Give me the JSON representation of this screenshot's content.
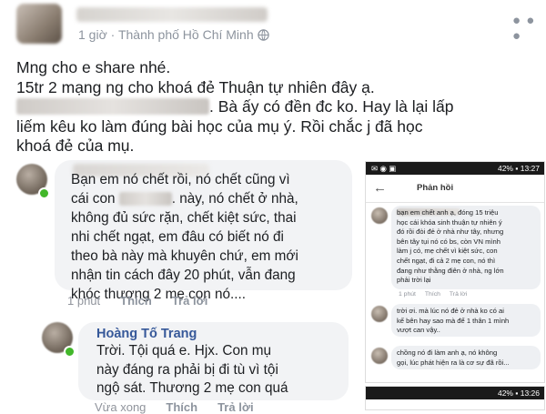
{
  "post": {
    "meta_time": "1 giờ",
    "meta_sep": " · ",
    "meta_location": "Thành phố Hồ Chí Minh",
    "lines": [
      "Mng cho e share nhé.",
      "15tr 2 mạng ng cho khoá đẻ Thuận tự nhiên đây ạ.",
      ". Bà ấy có đền đc ko. Hay là lại lấp",
      "liếm kêu ko làm đúng bài học của mụ ý. Rồi chắc j đã học",
      "khoá đẻ của mụ."
    ]
  },
  "comment1": {
    "lines": [
      "Bạn em nó chết rồi, nó chết cũng vì",
      "cái con",
      ". này, nó chết ở nhà,",
      "không đủ sức rặn, chết kiệt sức, thai",
      "nhi chết ngạt, em đâu có biết nó đi",
      "theo bà này mà khuyên chứ, em mới",
      "nhận tin cách đây 20 phút, vẫn đang",
      "khóc thương 2 mẹ con nó...."
    ],
    "time": "1 phút",
    "like": "Thích",
    "reply": "Trả lời"
  },
  "comment2": {
    "author": "Hoàng Tố Trang",
    "lines": [
      "Trời. Tội quá e. Hjx. Con mụ",
      "này đáng ra phải bị đi tù vì tội",
      "ngộ sát. Thương 2 mẹ con quá"
    ],
    "time": "Vừa xong",
    "like": "Thích",
    "reply": "Trả lời"
  },
  "phone": {
    "status_right": "42% ▪ 13:27",
    "header_title": "Phản hồi",
    "reply1_lines": [
      "bạn em chết anh ạ, đóng 15 triệu",
      "học cái khóa sinh thuận tự nhiên ý",
      "đó rồi đòi đẻ ở nhà như tây, nhưng",
      "bên tây tụi nó có bs, còn VN mình",
      "làm j có, mẹ chết vì kiệt sức, con",
      "chết ngạt, đi cả 2 mẹ con, nó thì",
      "đang như thằng điên ở nhà, ng lớn",
      "phải trời lại"
    ],
    "reply1_time": "1 phút",
    "like": "Thích",
    "reply": "Trả lời",
    "reply2_lines": [
      "trời ơi. mà lúc nó đẻ ở nhà ko có ai",
      "kế bên hay sao mà để 1 thân 1 mình",
      "vượt can vậy.."
    ],
    "reply3_lines": [
      "chồng nó đi làm anh ạ, nó không",
      "gọi, lúc phát hiện ra là cơ sự đã rồi..."
    ],
    "status2_right": "42% ▪ 13:26"
  }
}
